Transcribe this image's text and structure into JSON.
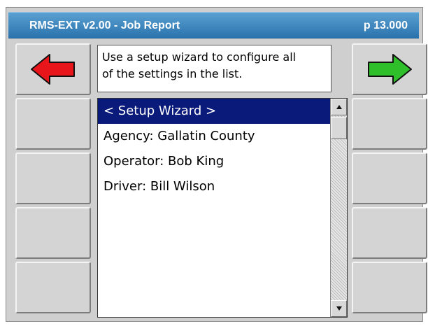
{
  "window": {
    "title": "RMS-EXT v2.00 - Job Report",
    "page_indicator": "p 13.000"
  },
  "help_text": {
    "line1": "Use a setup wizard to configure all",
    "line2": "of the settings in the list."
  },
  "navigation": {
    "back_icon": "left-arrow-icon",
    "forward_icon": "right-arrow-icon",
    "back_color": "#e8161b",
    "forward_color": "#2fbf2a"
  },
  "settings_list": {
    "items": [
      "< Setup Wizard >",
      "Agency: Gallatin County",
      "Operator: Bob King",
      "Driver: Bill Wilson"
    ],
    "selected_index": 0
  },
  "colors": {
    "title_bar": "#3a86c4",
    "selection": "#0a1a7a",
    "panel": "#cfcfcf"
  }
}
